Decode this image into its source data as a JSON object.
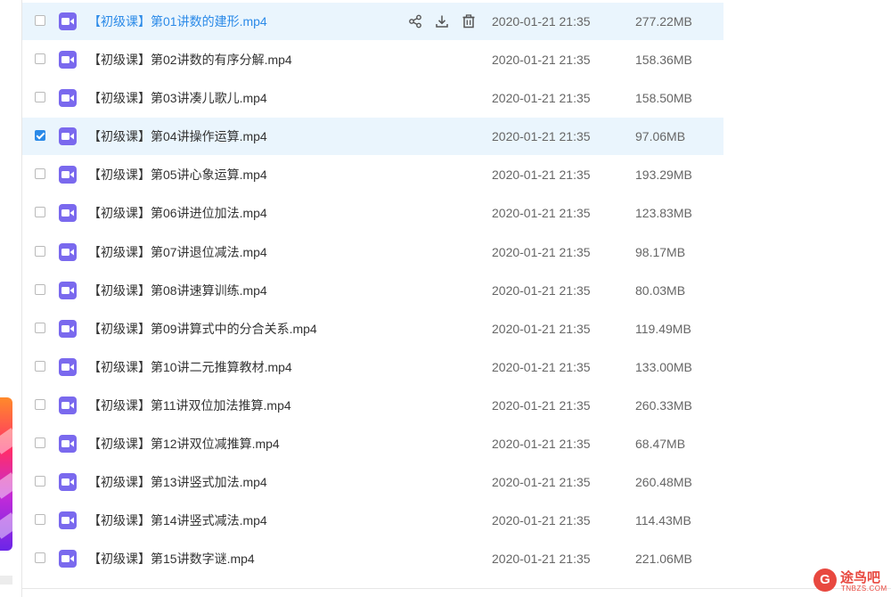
{
  "files": [
    {
      "name": "【初级课】第01讲数的建形.mp4",
      "date": "2020-01-21 21:35",
      "size": "277.22MB",
      "checked": false,
      "hovered": true
    },
    {
      "name": "【初级课】第02讲数的有序分解.mp4",
      "date": "2020-01-21 21:35",
      "size": "158.36MB",
      "checked": false,
      "hovered": false
    },
    {
      "name": "【初级课】第03讲凑儿歌儿.mp4",
      "date": "2020-01-21 21:35",
      "size": "158.50MB",
      "checked": false,
      "hovered": false
    },
    {
      "name": "【初级课】第04讲操作运算.mp4",
      "date": "2020-01-21 21:35",
      "size": "97.06MB",
      "checked": true,
      "hovered": false
    },
    {
      "name": "【初级课】第05讲心象运算.mp4",
      "date": "2020-01-21 21:35",
      "size": "193.29MB",
      "checked": false,
      "hovered": false
    },
    {
      "name": "【初级课】第06讲进位加法.mp4",
      "date": "2020-01-21 21:35",
      "size": "123.83MB",
      "checked": false,
      "hovered": false
    },
    {
      "name": "【初级课】第07讲退位减法.mp4",
      "date": "2020-01-21 21:35",
      "size": "98.17MB",
      "checked": false,
      "hovered": false
    },
    {
      "name": "【初级课】第08讲速算训练.mp4",
      "date": "2020-01-21 21:35",
      "size": "80.03MB",
      "checked": false,
      "hovered": false
    },
    {
      "name": "【初级课】第09讲算式中的分合关系.mp4",
      "date": "2020-01-21 21:35",
      "size": "119.49MB",
      "checked": false,
      "hovered": false
    },
    {
      "name": "【初级课】第10讲二元推算教材.mp4",
      "date": "2020-01-21 21:35",
      "size": "133.00MB",
      "checked": false,
      "hovered": false
    },
    {
      "name": "【初级课】第11讲双位加法推算.mp4",
      "date": "2020-01-21 21:35",
      "size": "260.33MB",
      "checked": false,
      "hovered": false
    },
    {
      "name": "【初级课】第12讲双位减推算.mp4",
      "date": "2020-01-21 21:35",
      "size": "68.47MB",
      "checked": false,
      "hovered": false
    },
    {
      "name": "【初级课】第13讲竖式加法.mp4",
      "date": "2020-01-21 21:35",
      "size": "260.48MB",
      "checked": false,
      "hovered": false
    },
    {
      "name": "【初级课】第14讲竖式减法.mp4",
      "date": "2020-01-21 21:35",
      "size": "114.43MB",
      "checked": false,
      "hovered": false
    },
    {
      "name": "【初级课】第15讲数字谜.mp4",
      "date": "2020-01-21 21:35",
      "size": "221.06MB",
      "checked": false,
      "hovered": false
    }
  ],
  "row_actions": [
    {
      "icon": "share-icon"
    },
    {
      "icon": "download-icon"
    },
    {
      "icon": "delete-icon"
    }
  ],
  "file_icon": "video-file-icon",
  "colors": {
    "accent": "#2b8ae8",
    "file_icon": "#7a69ee",
    "row_highlight": "#eaf5fd",
    "watermark": "#e8483f"
  },
  "watermark": {
    "logo_text": "G",
    "title": "途鸟吧",
    "subtitle": "TNBZS.COM"
  }
}
